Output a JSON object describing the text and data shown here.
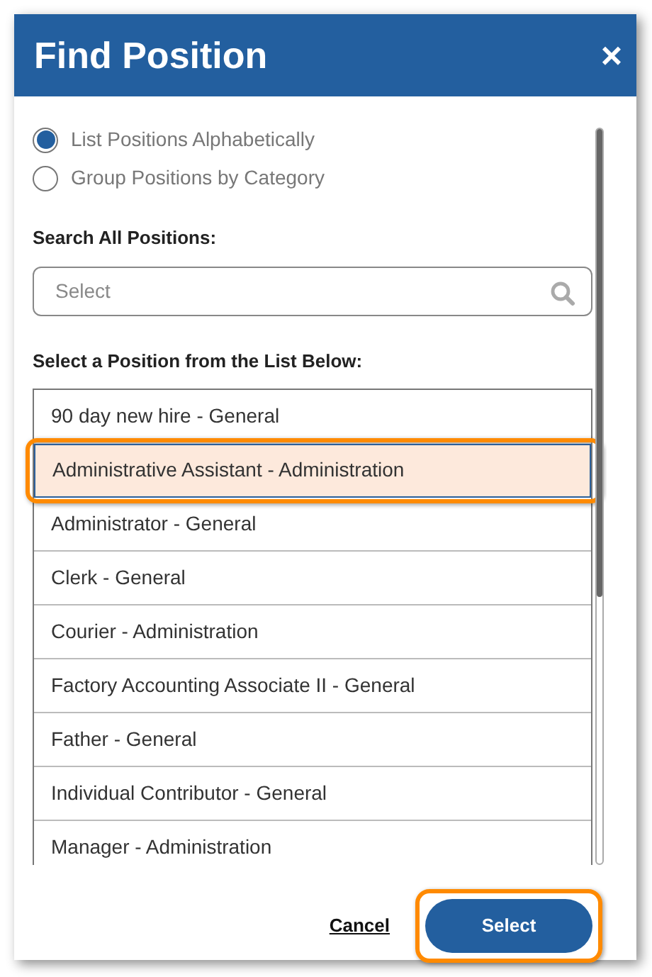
{
  "dialog": {
    "title": "Find Position",
    "close": "×"
  },
  "view_options": [
    {
      "label": "List Positions Alphabetically",
      "selected": true
    },
    {
      "label": "Group Positions by Category",
      "selected": false
    }
  ],
  "search": {
    "label": "Search All Positions:",
    "placeholder": "Select"
  },
  "list": {
    "label": "Select a Position from the List Below:",
    "items": [
      {
        "text": "90 day new hire - General",
        "selected": false,
        "highlighted": false
      },
      {
        "text": "Administrative Assistant - Administration",
        "selected": true,
        "highlighted": true
      },
      {
        "text": "Administrator - General",
        "selected": false,
        "highlighted": false
      },
      {
        "text": "Clerk - General",
        "selected": false,
        "highlighted": false
      },
      {
        "text": "Courier - Administration",
        "selected": false,
        "highlighted": false
      },
      {
        "text": "Factory Accounting Associate II - General",
        "selected": false,
        "highlighted": false
      },
      {
        "text": "Father - General",
        "selected": false,
        "highlighted": false
      },
      {
        "text": "Individual Contributor - General",
        "selected": false,
        "highlighted": false
      },
      {
        "text": "Manager - Administration",
        "selected": false,
        "highlighted": false
      }
    ]
  },
  "footer": {
    "cancel": "Cancel",
    "select": {
      "label": "Select",
      "highlighted": true
    }
  }
}
